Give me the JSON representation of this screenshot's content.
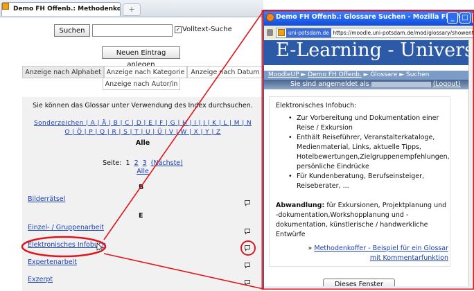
{
  "left_browser": {
    "tab_title": "Demo FH Offenb.: Methodenkoffer - ...",
    "new_tab_symbol": "+",
    "search_button": "Suchen",
    "search_value": "",
    "fulltext_checked": "✓",
    "fulltext_label": "Volltext-Suche",
    "new_entry_button": "Neuen Eintrag anlegen",
    "tabs": [
      "Anzeige nach Alphabet",
      "Anzeige nach Kategorie",
      "Anzeige nach Datum",
      "Anzeige nach Autor/in"
    ],
    "index_note": "Sie können das Glossar unter Verwendung des Index durchsuchen.",
    "letters_line1": "Sonderzeichen | A | Ä | B | C | D | E | F | G | H | I | J | K | L | M | N",
    "letters_line2": "O | Ö | P | Q | R | S | T | U | Ü | V | W | X | Y | Z",
    "all_label": "Alle",
    "pages_prefix": "Seite:",
    "pages": [
      "1",
      "2",
      "3"
    ],
    "next_label": "(Nächste)",
    "pages_all": "Alle",
    "groups": [
      "B",
      "E"
    ],
    "entries": [
      "Bilderrätsel",
      "Einzel- / Gruppenarbeit",
      "Elektronisches Infobuch",
      "Expertenarbeit",
      "Exzerpt"
    ],
    "comment_icon": "speech-bubble-icon"
  },
  "popup": {
    "title": "Demo FH Offenb.: Glossare Suchen - Mozilla Firefox",
    "window_buttons": [
      "_",
      "□",
      "X"
    ],
    "url_domain": "uni-potsdam.de",
    "url": "https://moodle.uni-potsdam.de/mod/glossary/showentry.p",
    "banner": "E-Learning - Univers",
    "breadcrumbs": {
      "home": "MoodleUP",
      "sep": "►",
      "course": "Demo FH Offenb.",
      "glossary": "Glossare",
      "search": "Suchen"
    },
    "logged_in_prefix": "Sie sind angemeldet als",
    "logout": "(Logout)",
    "entry_title": "Elektronisches Infobuch:",
    "bullets": [
      "Zur Vorbereitung und Dokumentation einer Reise / Exkursion",
      "Enthält Reiseführer, Veranstalterkataloge, Medienmaterial, Links, aktuelle Tipps, Hotelbewertungen,Zielgruppenempfehlungen, persönliche Eindrücke",
      "Für Kundenberatung, Berufseinsteiger, Reiseberater, ..."
    ],
    "variation_label": "Abwandlung:",
    "variation_text": "für Exkursionen, Projektplanung und -dokumentation,Workshopplanung und -dokumentation, künstlerische / handwerkliche Entwürfe",
    "example_prefix": "»",
    "example_link": "Methodenkoffer - Beispiel für ein Glossar mit Kommentarfunktion",
    "close_button": "Dieses Fenster schließen"
  },
  "colors": {
    "titlebar": "#0f4bdc",
    "banner": "#2c5aa7",
    "annotation": "#e0151b",
    "link": "#1a3fb0"
  }
}
